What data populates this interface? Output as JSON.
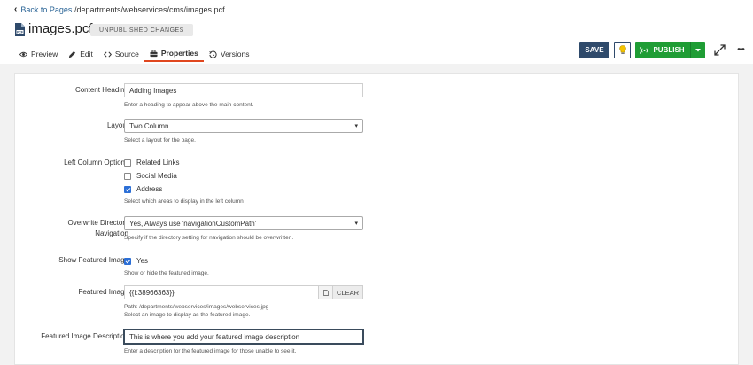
{
  "header": {
    "back_label": "Back to Pages",
    "path": "/departments/webservices/cms/images.pcf",
    "title": "images.pcf",
    "status_badge": "UNPUBLISHED CHANGES"
  },
  "tabs": [
    {
      "label": "Preview",
      "icon": "eye-icon"
    },
    {
      "label": "Edit",
      "icon": "pencil-icon"
    },
    {
      "label": "Source",
      "icon": "code-icon"
    },
    {
      "label": "Properties",
      "icon": "briefcase-icon",
      "active": true
    },
    {
      "label": "Versions",
      "icon": "history-icon"
    }
  ],
  "toolbar": {
    "save_label": "SAVE",
    "publish_label": "PUBLISH"
  },
  "colors": {
    "save": "#2f4a6b",
    "publish": "#1f9d35",
    "active_tab_underline": "#e0471f",
    "link": "#2a6496"
  },
  "form": {
    "content_heading": {
      "label": "Content Heading",
      "value": "Adding Images",
      "help": "Enter a heading to appear above the main content."
    },
    "layout": {
      "label": "Layout",
      "value": "Two Column",
      "help": "Select a layout for the page."
    },
    "left_column": {
      "label": "Left Column Options",
      "options": [
        {
          "label": "Related Links",
          "checked": false
        },
        {
          "label": "Social Media",
          "checked": false
        },
        {
          "label": "Address",
          "checked": true
        }
      ],
      "help": "Select which areas to display in the left column"
    },
    "overwrite_nav": {
      "label_line1": "Overwrite Directory",
      "label_line2": "Navigation",
      "value": "Yes, Always use 'navigationCustomPath'",
      "help": "Specify if the directory setting for navigation should be overwritten."
    },
    "show_featured": {
      "label": "Show Featured Image",
      "option": "Yes",
      "checked": true,
      "help": "Show or hide the featured image."
    },
    "featured_image": {
      "label": "Featured Image",
      "value": "{{f:38966363}}",
      "clear_label": "CLEAR",
      "path_text": "Path: /departments/webservices/images/webservices.jpg",
      "help": "Select an image to display as the featured image."
    },
    "featured_desc": {
      "label": "Featured Image Description",
      "value": "This is where you add your featured image description",
      "help": "Enter a description for the featured image for those unable to see it."
    }
  }
}
